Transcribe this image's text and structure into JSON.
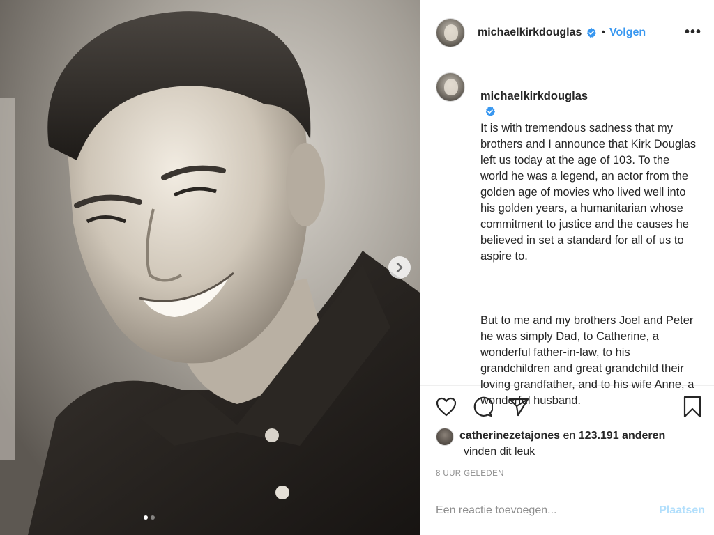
{
  "post": {
    "username": "michaelkirkdouglas",
    "verified": true,
    "follow_label": "Volgen",
    "bullet": "•",
    "more_label": "•••",
    "caption_paragraph_1": "It is with tremendous sadness that my brothers and I announce that Kirk Douglas left us today at the age of 103. To the world he was a legend, an actor from the golden age of movies who lived well into his golden years, a humanitarian whose commitment to justice and the causes he believed in set a standard for all of us to aspire to.",
    "caption_paragraph_2": "But to me and my brothers Joel and Peter he was simply Dad, to Catherine, a wonderful father-in-law, to his grandchildren and great grandchild their loving grandfather, and to his wife Anne, a wonderful husband."
  },
  "carousel": {
    "slide_count": 2,
    "active_index": 0
  },
  "likes": {
    "liker": "catherinezetajones",
    "connector": "en",
    "count_text": "123.191 anderen",
    "suffix": "vinden dit leuk"
  },
  "timestamp": "8 uur geleden",
  "comment": {
    "placeholder": "Een reactie toevoegen...",
    "post_label": "Plaatsen"
  },
  "icons": {
    "like": "heart-icon",
    "comment": "comment-icon",
    "share": "share-icon",
    "save": "bookmark-icon",
    "next": "chevron-right-icon",
    "verified": "verified-badge-icon"
  },
  "colors": {
    "accent": "#3897f0",
    "post_disabled": "#b2dffc",
    "muted": "#8e8e8e",
    "text": "#262626"
  }
}
